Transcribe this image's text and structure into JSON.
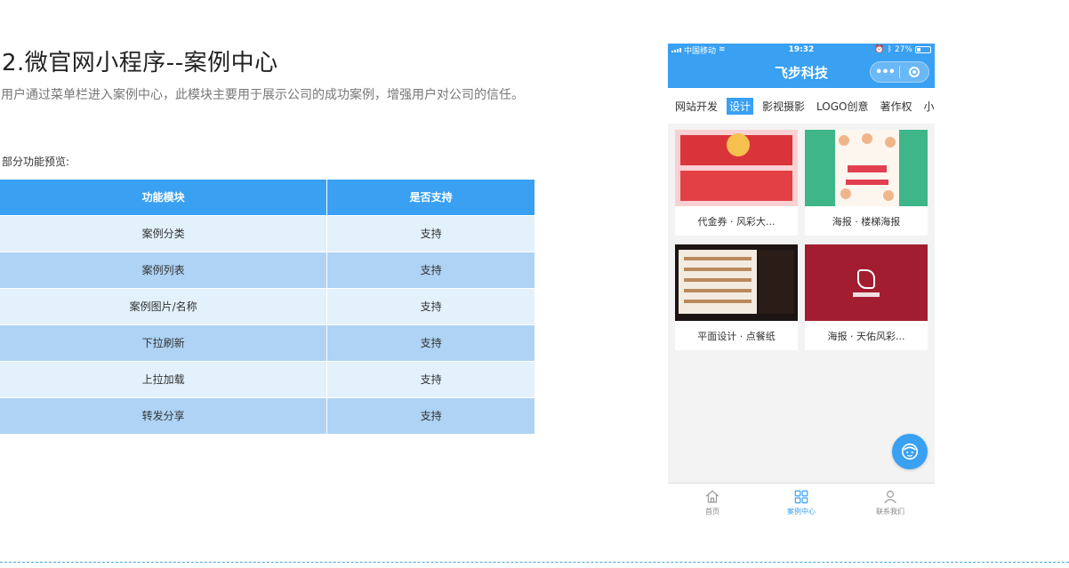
{
  "section": {
    "title": "2.微官网小程序--案例中心",
    "description": "用户通过菜单栏进入案例中心，此模块主要用于展示公司的成功案例，增强用户对公司的信任。",
    "preview_label": "部分功能预览:"
  },
  "table": {
    "headers": [
      "功能模块",
      "是否支持"
    ],
    "rows": [
      {
        "module": "案例分类",
        "support": "支持"
      },
      {
        "module": "案例列表",
        "support": "支持"
      },
      {
        "module": "案例图片/名称",
        "support": "支持"
      },
      {
        "module": "下拉刷新",
        "support": "支持"
      },
      {
        "module": "上拉加载",
        "support": "支持"
      },
      {
        "module": "转发分享",
        "support": "支持"
      }
    ]
  },
  "phone": {
    "status": {
      "carrier": "中国移动",
      "time": "19:32",
      "battery": "27%"
    },
    "nav_title": "飞步科技",
    "capsule_dots": "•••",
    "tabs": [
      {
        "label": "网站开发",
        "active": false
      },
      {
        "label": "设计",
        "active": true
      },
      {
        "label": "影视摄影",
        "active": false
      },
      {
        "label": "LOGO创意",
        "active": false
      },
      {
        "label": "著作权",
        "active": false
      },
      {
        "label": "小程",
        "active": false
      }
    ],
    "cases": [
      {
        "caption": "代金券 · 风彩大..."
      },
      {
        "caption": "海报 · 楼梯海报"
      },
      {
        "caption": "平面设计 · 点餐纸"
      },
      {
        "caption": "海报 · 天佑风彩..."
      }
    ],
    "tabbar": [
      {
        "label": "首页",
        "icon": "home-icon",
        "active": false
      },
      {
        "label": "案例中心",
        "icon": "grid-icon",
        "active": true
      },
      {
        "label": "联系我们",
        "icon": "user-icon",
        "active": false
      }
    ],
    "colors": {
      "accent": "#39a0f2"
    }
  }
}
